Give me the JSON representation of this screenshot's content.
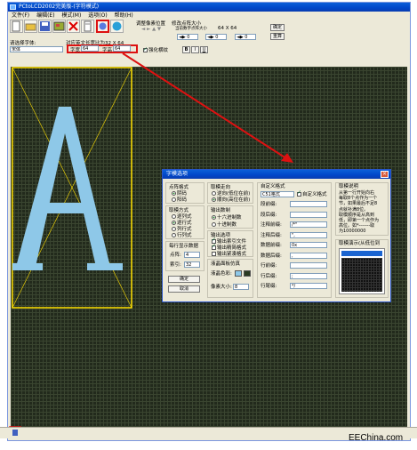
{
  "window": {
    "title": "PCtoLCD2002完美版-(字符模式)"
  },
  "menu": [
    "文件(F)",
    "编辑(E)",
    "模式(M)",
    "选项(O)",
    "帮助(H)"
  ],
  "toolbar": {
    "display_label": "调整像素位置",
    "resize_label": "修改点阵大小",
    "current_size_label": "当前数字点阵大小",
    "current_size_value": "64 X 64",
    "confirm_button": "确定",
    "extend_button": "重算",
    "font_label": "请选择字体:",
    "font_value": "宋体",
    "size_label_w": "字宽",
    "size_label_h": "字高",
    "width_value": "64",
    "height_value": "64",
    "font_preview_label": "对应英文长宽比为32 X 64",
    "lattice_checkbox": "强化横纹",
    "bold": "B",
    "italic": "I",
    "underline": "U"
  },
  "dialog": {
    "title": "字模选项",
    "dot_format_label": "点阵格式",
    "dot_format_options": [
      "阴码",
      "阳码"
    ],
    "dot_format_selected": 0,
    "mode_label": "取模方式",
    "mode_options": [
      "逐列式",
      "逐行式",
      "列行式",
      "行列式"
    ],
    "mode_selected": 1,
    "per_line_label": "每行显示数据",
    "dot_array_label": "点阵:",
    "dot_array_value": "4",
    "index_label": "索引:",
    "index_value": "32",
    "ok_button": "确定",
    "cancel_button": "取消",
    "direction_label": "取模走向",
    "direction_options": [
      "逆向(低位在前)",
      "顺向(高位在前)"
    ],
    "direction_selected": 1,
    "output_label": "输出数制",
    "output_options": [
      "十六进制数",
      "十进制数"
    ],
    "output_selected": 0,
    "output_options_label": "输出选项",
    "output_checks": [
      "输出索引文件",
      "输出精简格式",
      "输出紧凑格式"
    ],
    "output_checked": [
      true,
      true,
      false
    ],
    "lcd_sim_label": "液晶面板仿真",
    "lcd_color_label": "液晶色彩:",
    "pixel_size_label": "像素大小:",
    "pixel_size_value": "8",
    "custom_label": "自定义格式",
    "custom_select": "C51格式",
    "custom_check": "自定义格式",
    "custom_fields": [
      {
        "label": "段前缀:",
        "value": ""
      },
      {
        "label": "段后缀:",
        "value": ""
      },
      {
        "label": "注释前缀:",
        "value": "/*\""
      },
      {
        "label": "注释后缀:",
        "value": "\","
      },
      {
        "label": "数据前缀:",
        "value": "0x"
      },
      {
        "label": "数据后缀:",
        "value": ","
      },
      {
        "label": "行前缀:",
        "value": ""
      },
      {
        "label": "行后缀:",
        "value": ";"
      },
      {
        "label": "行尾缀:",
        "value": "*/"
      }
    ],
    "help_title": "取模说明",
    "help_text": [
      "从第一行开始向右",
      "每取8个点作为一个",
      "节，如果最后不足8",
      "点就补满8位。",
      "取模顺序是从高到",
      "低，即第一个点作为",
      "高位。如*-------取",
      "为10000000"
    ],
    "preview_label": "取模演示(从低位到"
  },
  "watermark": "EEChina.com",
  "colors": {
    "accent": "#0046c8",
    "grid_bg": "#222a1c",
    "glyph": "#8ec8e8",
    "arrow": "#dd1111",
    "highlight": "#ffe000"
  }
}
